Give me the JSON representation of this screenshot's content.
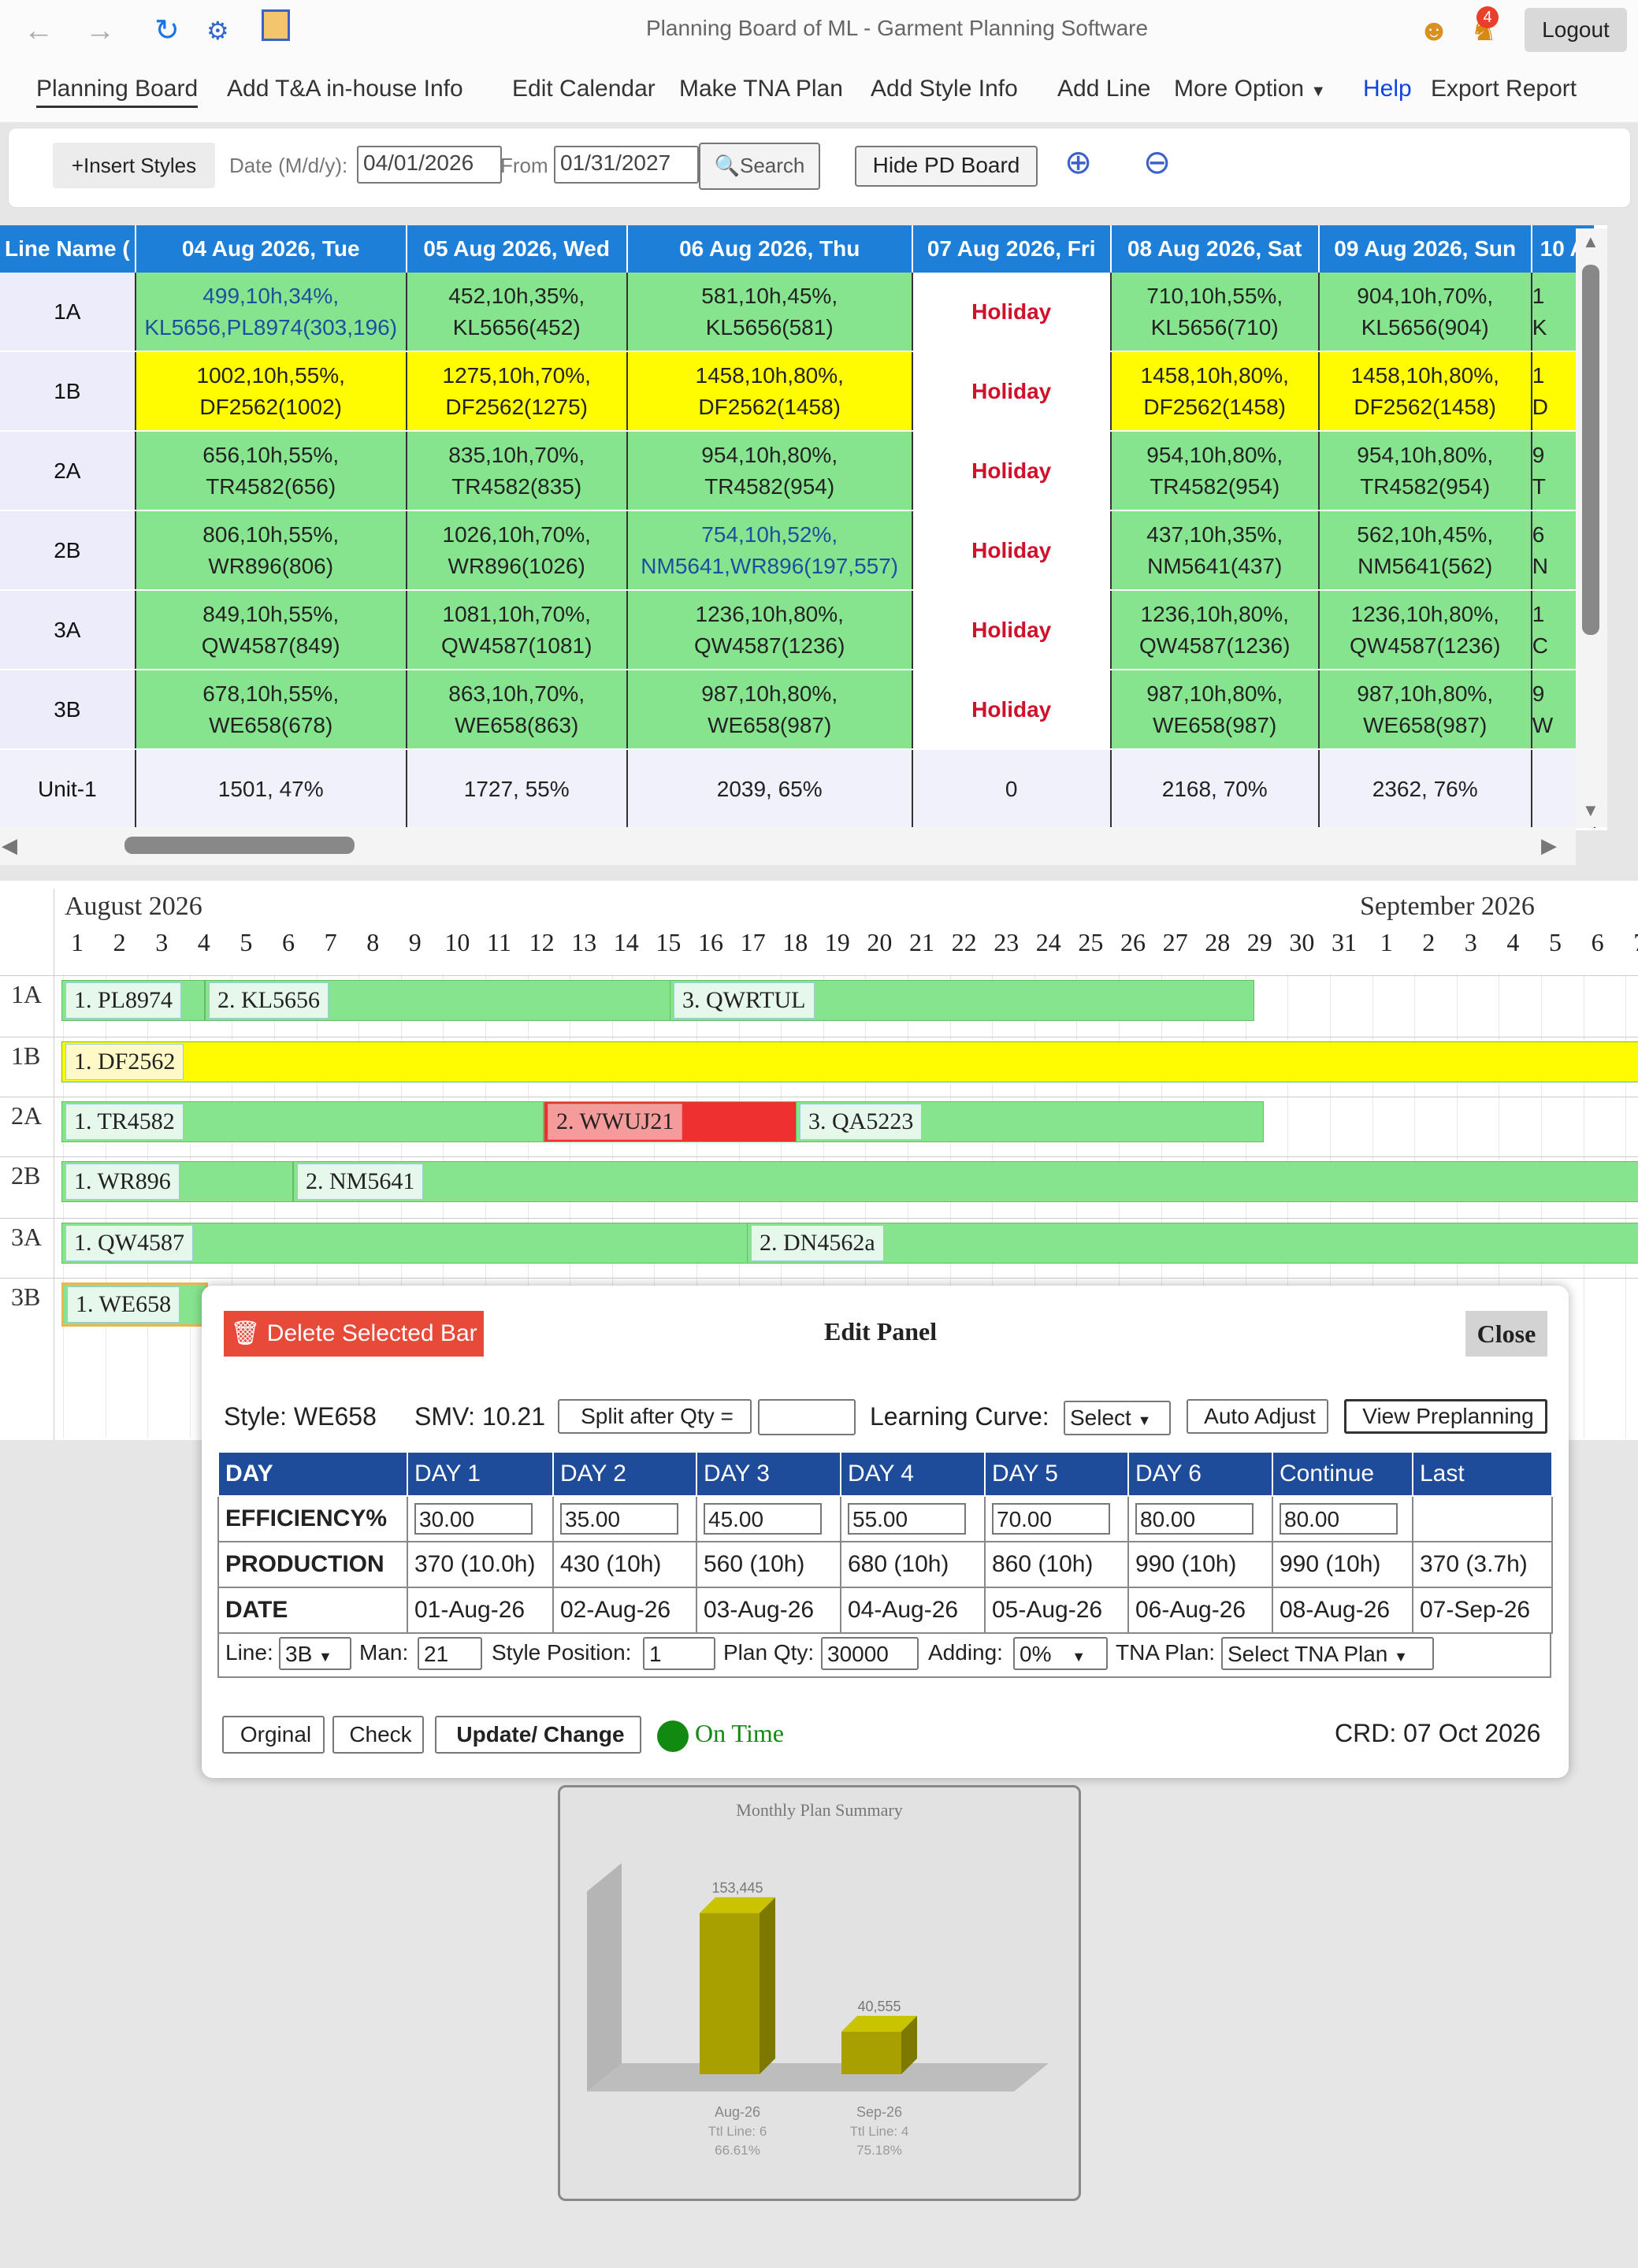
{
  "app": {
    "title": "Planning Board of ML - Garment Planning Software",
    "logout": "Logout",
    "notification_count": "4"
  },
  "menu": [
    "Planning Board",
    "Add T&A in-house Info",
    "Edit Calendar",
    "Make TNA Plan",
    "Add Style Info",
    "Add Line",
    "More Option",
    "Help",
    "Export Report"
  ],
  "toolbar": {
    "insert_styles": "+Insert Styles",
    "date_label": "Date (M/d/y):",
    "date_value": "04/01/2026",
    "from_label": "From",
    "from_value": "01/31/2027",
    "search": "Search",
    "hide_pd": "Hide PD Board"
  },
  "grid": {
    "headers": [
      "Line Name (",
      "04 Aug 2026, Tue",
      "05 Aug 2026, Wed",
      "06 Aug 2026, Thu",
      "07 Aug 2026, Fri",
      "08 Aug 2026, Sat",
      "09 Aug 2026, Sun",
      "10 A"
    ],
    "rows": [
      {
        "line": "1A",
        "cells": [
          [
            "499,10h,34%,",
            "KL5656,PL8974(303,196)"
          ],
          [
            "452,10h,35%,",
            "KL5656(452)"
          ],
          [
            "581,10h,45%,",
            "KL5656(581)"
          ],
          [
            "Holiday"
          ],
          [
            "710,10h,55%,",
            "KL5656(710)"
          ],
          [
            "904,10h,70%,",
            "KL5656(904)"
          ],
          [
            "1",
            "K"
          ]
        ]
      },
      {
        "line": "1B",
        "cells": [
          [
            "1002,10h,55%,",
            "DF2562(1002)"
          ],
          [
            "1275,10h,70%,",
            "DF2562(1275)"
          ],
          [
            "1458,10h,80%,",
            "DF2562(1458)"
          ],
          [
            "Holiday"
          ],
          [
            "1458,10h,80%,",
            "DF2562(1458)"
          ],
          [
            "1458,10h,80%,",
            "DF2562(1458)"
          ],
          [
            "1",
            "D"
          ]
        ]
      },
      {
        "line": "2A",
        "cells": [
          [
            "656,10h,55%,",
            "TR4582(656)"
          ],
          [
            "835,10h,70%,",
            "TR4582(835)"
          ],
          [
            "954,10h,80%,",
            "TR4582(954)"
          ],
          [
            "Holiday"
          ],
          [
            "954,10h,80%,",
            "TR4582(954)"
          ],
          [
            "954,10h,80%,",
            "TR4582(954)"
          ],
          [
            "9",
            "T"
          ]
        ]
      },
      {
        "line": "2B",
        "cells": [
          [
            "806,10h,55%,",
            "WR896(806)"
          ],
          [
            "1026,10h,70%,",
            "WR896(1026)"
          ],
          [
            "754,10h,52%,",
            "NM5641,WR896(197,557)"
          ],
          [
            "Holiday"
          ],
          [
            "437,10h,35%,",
            "NM5641(437)"
          ],
          [
            "562,10h,45%,",
            "NM5641(562)"
          ],
          [
            "6",
            "N"
          ]
        ]
      },
      {
        "line": "3A",
        "cells": [
          [
            "849,10h,55%,",
            "QW4587(849)"
          ],
          [
            "1081,10h,70%,",
            "QW4587(1081)"
          ],
          [
            "1236,10h,80%,",
            "QW4587(1236)"
          ],
          [
            "Holiday"
          ],
          [
            "1236,10h,80%,",
            "QW4587(1236)"
          ],
          [
            "1236,10h,80%,",
            "QW4587(1236)"
          ],
          [
            "1",
            "C"
          ]
        ]
      },
      {
        "line": "3B",
        "cells": [
          [
            "678,10h,55%,",
            "WE658(678)"
          ],
          [
            "863,10h,70%,",
            "WE658(863)"
          ],
          [
            "987,10h,80%,",
            "WE658(987)"
          ],
          [
            "Holiday"
          ],
          [
            "987,10h,80%,",
            "WE658(987)"
          ],
          [
            "987,10h,80%,",
            "WE658(987)"
          ],
          [
            "9",
            "W"
          ]
        ]
      }
    ],
    "total": {
      "line": "Unit-1",
      "cells": [
        "1501, 47%",
        "1727, 55%",
        "2039, 65%",
        "0",
        "2168, 70%",
        "2362, 76%",
        ""
      ]
    }
  },
  "gantt": {
    "month1": "August 2026",
    "month2": "September 2026",
    "days": [
      "1",
      "2",
      "3",
      "4",
      "5",
      "6",
      "7",
      "8",
      "9",
      "10",
      "11",
      "12",
      "13",
      "14",
      "15",
      "16",
      "17",
      "18",
      "19",
      "20",
      "21",
      "22",
      "23",
      "24",
      "25",
      "26",
      "27",
      "28",
      "29",
      "30",
      "31",
      "1",
      "2",
      "3",
      "4",
      "5",
      "6",
      "7"
    ],
    "lines": [
      "1A",
      "1B",
      "2A",
      "2B",
      "3A",
      "3B"
    ],
    "bars": [
      {
        "label": "1. PL8974"
      },
      {
        "label": "2. KL5656"
      },
      {
        "label": "3. QWRTUL"
      },
      {
        "label": "1. DF2562"
      },
      {
        "label": "1. TR4582"
      },
      {
        "label": "2. WWUJ21"
      },
      {
        "label": "3. QA5223"
      },
      {
        "label": "1. WR896"
      },
      {
        "label": "2. NM5641"
      },
      {
        "label": "1. QW4587"
      },
      {
        "label": "2. DN4562a"
      },
      {
        "label": "1. WE658"
      }
    ]
  },
  "panel": {
    "delete": "Delete Selected Bar",
    "title": "Edit Panel",
    "close": "Close",
    "style": "Style: WE658",
    "smv": "SMV: 10.21",
    "split": "Split after Qty =",
    "learning_curve": "Learning Curve:",
    "lc_select": "Select",
    "auto_adjust": "Auto Adjust",
    "view_preplanning": "View Preplanning",
    "table_headers": [
      "DAY",
      "DAY 1",
      "DAY 2",
      "DAY 3",
      "DAY 4",
      "DAY 5",
      "DAY 6",
      "Continue",
      "Last"
    ],
    "efficiency_label": "EFFICIENCY%",
    "efficiency": [
      "30.00",
      "35.00",
      "45.00",
      "55.00",
      "70.00",
      "80.00",
      "80.00"
    ],
    "production_label": "PRODUCTION",
    "production": [
      "370 (10.0h)",
      "430 (10h)",
      "560 (10h)",
      "680 (10h)",
      "860 (10h)",
      "990 (10h)",
      "990 (10h)",
      "370 (3.7h)"
    ],
    "date_label": "DATE",
    "dates": [
      "01-Aug-26",
      "02-Aug-26",
      "03-Aug-26",
      "04-Aug-26",
      "05-Aug-26",
      "06-Aug-26",
      "08-Aug-26",
      "07-Sep-26"
    ],
    "line_label": "Line:",
    "line_value": "3B",
    "man_label": "Man:",
    "man_value": "21",
    "style_pos_label": "Style Position:",
    "style_pos_value": "1",
    "plan_qty_label": "Plan Qty:",
    "plan_qty_value": "30000",
    "adding_label": "Adding:",
    "adding_value": "0%",
    "tna_label": "TNA Plan:",
    "tna_value": "Select TNA Plan",
    "original": "Orginal",
    "check": "Check",
    "update": "Update/ Change",
    "status": "On Time",
    "crd": "CRD: 07 Oct 2026"
  },
  "chart_data": {
    "type": "bar",
    "title": "Monthly Plan Summary",
    "categories": [
      "Aug-26",
      "Sep-26"
    ],
    "values": [
      153445,
      40555
    ],
    "value_labels": [
      "153,445",
      "40,555"
    ],
    "sublabels": [
      [
        "Ttl Line: 6",
        "66.61%"
      ],
      [
        "Ttl Line: 4",
        "75.18%"
      ]
    ],
    "ylim": [
      0,
      180000
    ],
    "color": "#a7a000"
  }
}
